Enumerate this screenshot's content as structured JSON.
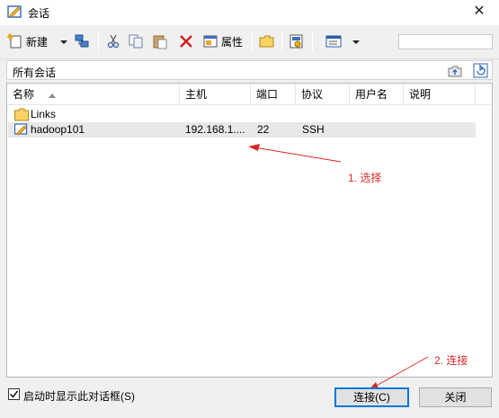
{
  "window": {
    "title": "会话"
  },
  "toolbar": {
    "new_label": "新建",
    "properties_label": "属性",
    "search_value": ""
  },
  "path": {
    "label": "所有会话"
  },
  "list": {
    "columns": [
      "名称",
      "主机",
      "端口",
      "协议",
      "用户名",
      "说明"
    ],
    "rows": [
      {
        "name": "Links",
        "host": "",
        "port": "",
        "protocol": "",
        "user": "",
        "note": "",
        "icon": "folder-icon"
      },
      {
        "name": "hadoop101",
        "host": "192.168.1....",
        "port": "22",
        "protocol": "SSH",
        "user": "",
        "note": "",
        "icon": "session-icon"
      }
    ]
  },
  "annotations": {
    "step1": "1. 选择",
    "step2": "2. 连接",
    "color": "#d62a2a"
  },
  "footer": {
    "show_on_startup_label": "启动时显示此对话框(S)",
    "show_on_startup_checked": true,
    "connect_label": "连接(C)",
    "close_label": "关闭"
  }
}
